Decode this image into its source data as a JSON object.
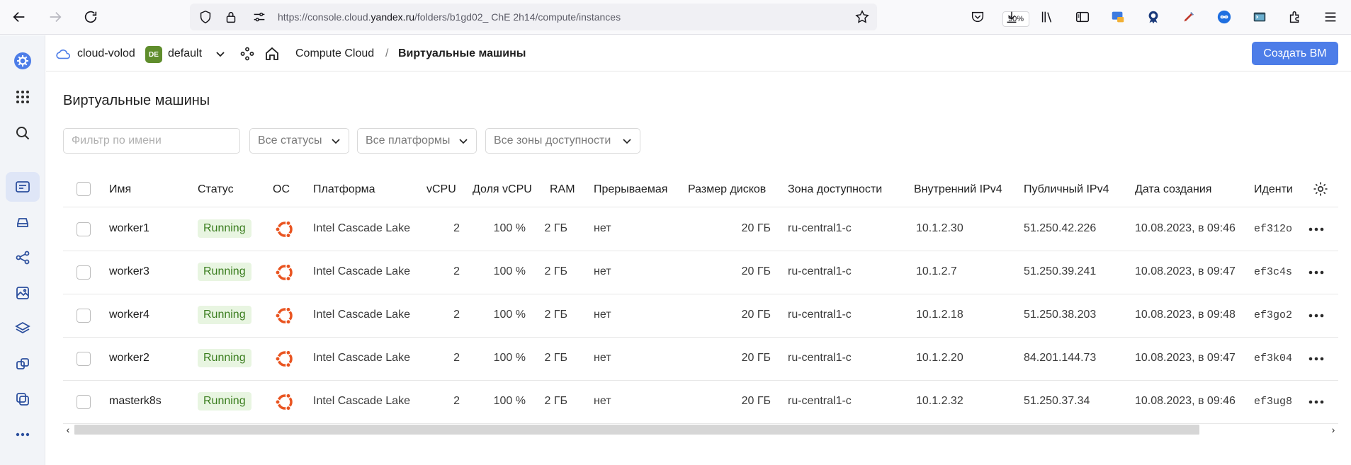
{
  "browser": {
    "url_prefix": "https://console.cloud.",
    "url_domain": "yandex.ru",
    "url_path": "/folders/b1gd02_  ChE  2h14/compute/instances",
    "zoom": "90%"
  },
  "header": {
    "cloud": "cloud-volod",
    "folder_badge": "DE",
    "folder": "default",
    "breadcrumb_service": "Compute Cloud",
    "breadcrumb_sep": "/",
    "breadcrumb_page": "Виртуальные машины",
    "create_button": "Создать ВМ"
  },
  "main": {
    "title": "Виртуальные машины",
    "filter_placeholder": "Фильтр по имени",
    "status_select": "Все статусы",
    "platform_select": "Все платформы",
    "zone_select": "Все зоны доступности"
  },
  "table": {
    "columns": {
      "name": "Имя",
      "status": "Статус",
      "os": "ОС",
      "platform": "Платформа",
      "vcpu": "vCPU",
      "vcpu_share": "Доля vCPU",
      "ram": "RAM",
      "preemptible": "Прерываемая",
      "disk": "Размер дисков",
      "zone": "Зона доступности",
      "ipv4_internal": "Внутренний IPv4",
      "ipv4_public": "Публичный IPv4",
      "created": "Дата создания",
      "id": "Иденти"
    },
    "rows": [
      {
        "name": "worker1",
        "status": "Running",
        "platform": "Intel Cascade Lake",
        "vcpu": "2",
        "vcpu_share": "100 %",
        "ram": "2 ГБ",
        "preemptible": "нет",
        "disk": "20 ГБ",
        "zone": "ru-central1-c",
        "ip_int": "10.1.2.30",
        "ip_pub": "51.250.42.226",
        "created": "10.08.2023, в 09:46",
        "id": "ef312o"
      },
      {
        "name": "worker3",
        "status": "Running",
        "platform": "Intel Cascade Lake",
        "vcpu": "2",
        "vcpu_share": "100 %",
        "ram": "2 ГБ",
        "preemptible": "нет",
        "disk": "20 ГБ",
        "zone": "ru-central1-c",
        "ip_int": "10.1.2.7",
        "ip_pub": "51.250.39.241",
        "created": "10.08.2023, в 09:47",
        "id": "ef3c4s"
      },
      {
        "name": "worker4",
        "status": "Running",
        "platform": "Intel Cascade Lake",
        "vcpu": "2",
        "vcpu_share": "100 %",
        "ram": "2 ГБ",
        "preemptible": "нет",
        "disk": "20 ГБ",
        "zone": "ru-central1-c",
        "ip_int": "10.1.2.18",
        "ip_pub": "51.250.38.203",
        "created": "10.08.2023, в 09:48",
        "id": "ef3go2"
      },
      {
        "name": "worker2",
        "status": "Running",
        "platform": "Intel Cascade Lake",
        "vcpu": "2",
        "vcpu_share": "100 %",
        "ram": "2 ГБ",
        "preemptible": "нет",
        "disk": "20 ГБ",
        "zone": "ru-central1-c",
        "ip_int": "10.1.2.20",
        "ip_pub": "84.201.144.73",
        "created": "10.08.2023, в 09:47",
        "id": "ef3k04"
      },
      {
        "name": "masterk8s",
        "status": "Running",
        "platform": "Intel Cascade Lake",
        "vcpu": "2",
        "vcpu_share": "100 %",
        "ram": "2 ГБ",
        "preemptible": "нет",
        "disk": "20 ГБ",
        "zone": "ru-central1-c",
        "ip_int": "10.1.2.32",
        "ip_pub": "51.250.37.34",
        "created": "10.08.2023, в 09:46",
        "id": "ef3ug8"
      }
    ]
  },
  "colors": {
    "accent": "#4d7de8",
    "status_running_bg": "#e8f5e1",
    "status_running_text": "#3a7d1e",
    "ubuntu": "#e95420",
    "folder_badge": "#5f8d2c"
  }
}
